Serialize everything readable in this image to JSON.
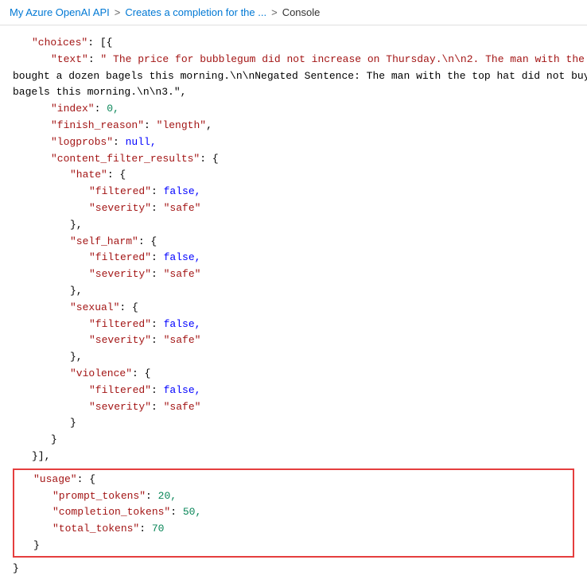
{
  "breadcrumb": {
    "part1": "My Azure OpenAI API",
    "separator1": ">",
    "part2": "Creates a completion for the ...",
    "separator2": ">",
    "part3": "Console"
  },
  "colors": {
    "key": "#a31515",
    "string_value": "#a31515",
    "number": "#098658",
    "null_bool": "#0000ff",
    "punct": "#333333",
    "highlight_border": "#e53e3e"
  },
  "code": {
    "lines": [
      {
        "indent": 1,
        "content": "\"choices\": [{"
      },
      {
        "indent": 2,
        "content": "\"text\": \" The price for bubblegum did not increase on Thursday.\\n\\n2. The man with the top hat"
      },
      {
        "indent": 0,
        "content": "bought a dozen bagels this morning.\\n\\nNegated Sentence: The man with the top hat did not buy a dozen"
      },
      {
        "indent": 0,
        "content": "bagels this morning.\\n\\n3.\","
      },
      {
        "indent": 2,
        "content": "\"index\": 0,"
      },
      {
        "indent": 2,
        "content": "\"finish_reason\": \"length\","
      },
      {
        "indent": 2,
        "content": "\"logprobs\": null,"
      },
      {
        "indent": 2,
        "content": "\"content_filter_results\": {"
      },
      {
        "indent": 3,
        "content": "\"hate\": {"
      },
      {
        "indent": 4,
        "content": "\"filtered\": false,"
      },
      {
        "indent": 4,
        "content": "\"severity\": \"safe\""
      },
      {
        "indent": 3,
        "content": "},"
      },
      {
        "indent": 3,
        "content": "\"self_harm\": {"
      },
      {
        "indent": 4,
        "content": "\"filtered\": false,"
      },
      {
        "indent": 4,
        "content": "\"severity\": \"safe\""
      },
      {
        "indent": 3,
        "content": "},"
      },
      {
        "indent": 3,
        "content": "\"sexual\": {"
      },
      {
        "indent": 4,
        "content": "\"filtered\": false,"
      },
      {
        "indent": 4,
        "content": "\"severity\": \"safe\""
      },
      {
        "indent": 3,
        "content": "},"
      },
      {
        "indent": 3,
        "content": "\"violence\": {"
      },
      {
        "indent": 4,
        "content": "\"filtered\": false,"
      },
      {
        "indent": 4,
        "content": "\"severity\": \"safe\""
      },
      {
        "indent": 3,
        "content": "}"
      },
      {
        "indent": 2,
        "content": "}"
      },
      {
        "indent": 1,
        "content": "}],"
      },
      {
        "indent": 1,
        "content": "\"usage\": {",
        "highlight_start": true
      },
      {
        "indent": 2,
        "content": "\"prompt_tokens\": 20,",
        "highlight": true
      },
      {
        "indent": 2,
        "content": "\"completion_tokens\": 50,",
        "highlight": true
      },
      {
        "indent": 2,
        "content": "\"total_tokens\": 70",
        "highlight": true
      },
      {
        "indent": 1,
        "content": "}",
        "highlight_end": true
      },
      {
        "indent": 0,
        "content": "}"
      }
    ]
  }
}
